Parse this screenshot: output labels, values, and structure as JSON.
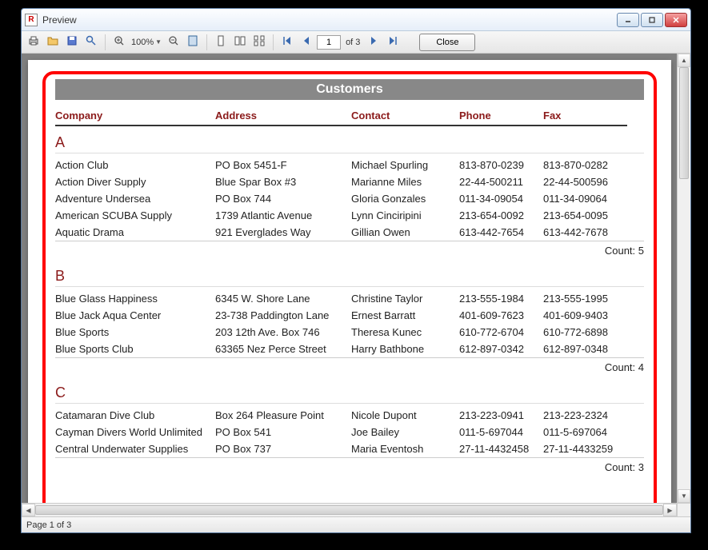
{
  "window": {
    "title": "Preview"
  },
  "toolbar": {
    "zoom_value": "100%",
    "page_current": "1",
    "page_of": "of 3",
    "close_label": "Close"
  },
  "report": {
    "title": "Customers",
    "headers": {
      "company": "Company",
      "address": "Address",
      "contact": "Contact",
      "phone": "Phone",
      "fax": "Fax"
    },
    "count_label": "Count: ",
    "groups": [
      {
        "letter": "A",
        "count": 5,
        "rows": [
          {
            "company": "Action Club",
            "address": "PO Box 5451-F",
            "contact": "Michael Spurling",
            "phone": "813-870-0239",
            "fax": "813-870-0282"
          },
          {
            "company": "Action Diver Supply",
            "address": "Blue Spar Box #3",
            "contact": "Marianne Miles",
            "phone": "22-44-500211",
            "fax": "22-44-500596"
          },
          {
            "company": "Adventure Undersea",
            "address": "PO Box 744",
            "contact": "Gloria Gonzales",
            "phone": "011-34-09054",
            "fax": "011-34-09064"
          },
          {
            "company": "American SCUBA Supply",
            "address": "1739 Atlantic Avenue",
            "contact": "Lynn Cinciripini",
            "phone": "213-654-0092",
            "fax": "213-654-0095"
          },
          {
            "company": "Aquatic Drama",
            "address": "921 Everglades Way",
            "contact": "Gillian Owen",
            "phone": "613-442-7654",
            "fax": "613-442-7678"
          }
        ]
      },
      {
        "letter": "B",
        "count": 4,
        "rows": [
          {
            "company": "Blue Glass Happiness",
            "address": "6345 W. Shore Lane",
            "contact": "Christine Taylor",
            "phone": "213-555-1984",
            "fax": "213-555-1995"
          },
          {
            "company": "Blue Jack Aqua Center",
            "address": "23-738 Paddington Lane",
            "contact": "Ernest Barratt",
            "phone": "401-609-7623",
            "fax": "401-609-9403"
          },
          {
            "company": "Blue Sports",
            "address": "203 12th Ave. Box 746",
            "contact": "Theresa Kunec",
            "phone": "610-772-6704",
            "fax": "610-772-6898"
          },
          {
            "company": "Blue Sports Club",
            "address": "63365 Nez Perce Street",
            "contact": "Harry Bathbone",
            "phone": "612-897-0342",
            "fax": "612-897-0348"
          }
        ]
      },
      {
        "letter": "C",
        "count": 3,
        "rows": [
          {
            "company": "Catamaran Dive Club",
            "address": "Box 264 Pleasure Point",
            "contact": "Nicole Dupont",
            "phone": "213-223-0941",
            "fax": "213-223-2324"
          },
          {
            "company": "Cayman Divers World Unlimited",
            "address": "PO Box 541",
            "contact": "Joe Bailey",
            "phone": "011-5-697044",
            "fax": "011-5-697064"
          },
          {
            "company": "Central Underwater Supplies",
            "address": "PO Box 737",
            "contact": "Maria Eventosh",
            "phone": "27-11-4432458",
            "fax": "27-11-4433259"
          }
        ]
      }
    ]
  },
  "statusbar": {
    "page_status": "Page 1 of 3"
  }
}
